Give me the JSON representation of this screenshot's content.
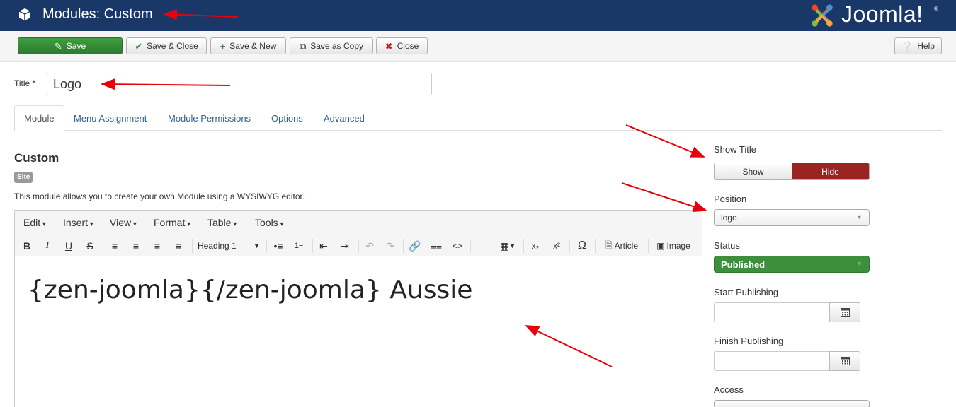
{
  "header": {
    "title": "Modules: Custom",
    "brand": "Joomla!",
    "brand_mark": "®"
  },
  "toolbar": {
    "save": "Save",
    "save_close": "Save & Close",
    "save_new": "Save & New",
    "save_copy": "Save as Copy",
    "close": "Close",
    "help": "Help"
  },
  "title_field": {
    "label": "Title *",
    "value": "Logo"
  },
  "tabs": [
    {
      "label": "Module",
      "active": true
    },
    {
      "label": "Menu Assignment"
    },
    {
      "label": "Module Permissions"
    },
    {
      "label": "Options"
    },
    {
      "label": "Advanced"
    }
  ],
  "module": {
    "heading": "Custom",
    "badge": "Site",
    "description": "This module allows you to create your own Module using a WYSIWYG editor."
  },
  "editor": {
    "menus": [
      "Edit",
      "Insert",
      "View",
      "Format",
      "Table",
      "Tools"
    ],
    "format_select": "Heading 1",
    "article_button": "Article",
    "image_button": "Image",
    "content": "{zen-joomla}{/zen-joomla} Aussie"
  },
  "sidebar": {
    "show_title": {
      "label": "Show Title",
      "show": "Show",
      "hide": "Hide",
      "selected": "Hide"
    },
    "position": {
      "label": "Position",
      "value": "logo"
    },
    "status": {
      "label": "Status",
      "value": "Published"
    },
    "start_publishing": {
      "label": "Start Publishing",
      "value": ""
    },
    "finish_publishing": {
      "label": "Finish Publishing",
      "value": ""
    },
    "access": {
      "label": "Access"
    }
  },
  "colors": {
    "header_bg": "#1a3867",
    "save_green": "#2d7b2d",
    "hide_red": "#9b2422",
    "status_green": "#3d8f3d",
    "annotation_arrow": "#e8000b"
  }
}
